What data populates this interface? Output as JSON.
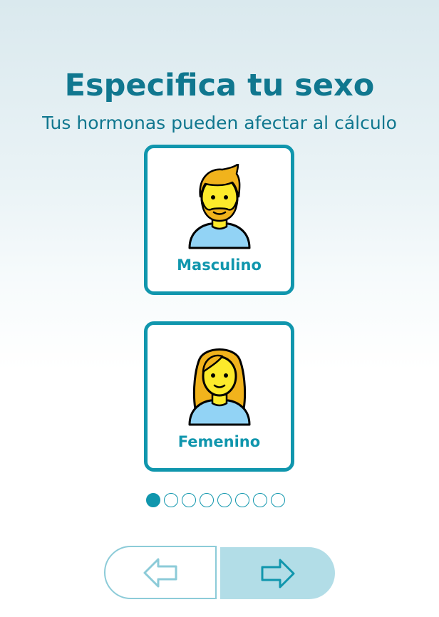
{
  "header": {
    "title": "Especifica tu sexo",
    "subtitle": "Tus hormonas pueden afectar al cálculo"
  },
  "options": [
    {
      "label": "Masculino",
      "icon": "man-avatar-icon",
      "selected": false
    },
    {
      "label": "Femenino",
      "icon": "woman-avatar-icon",
      "selected": false
    }
  ],
  "progress": {
    "total_steps": 8,
    "current_step": 1
  },
  "navigation": {
    "prev_icon": "arrow-left-icon",
    "next_icon": "arrow-right-icon"
  },
  "colors": {
    "accent": "#1096ad",
    "title": "#10778f",
    "next_button_bg": "#b2dde7",
    "prev_button_border": "#8ccbd8"
  }
}
